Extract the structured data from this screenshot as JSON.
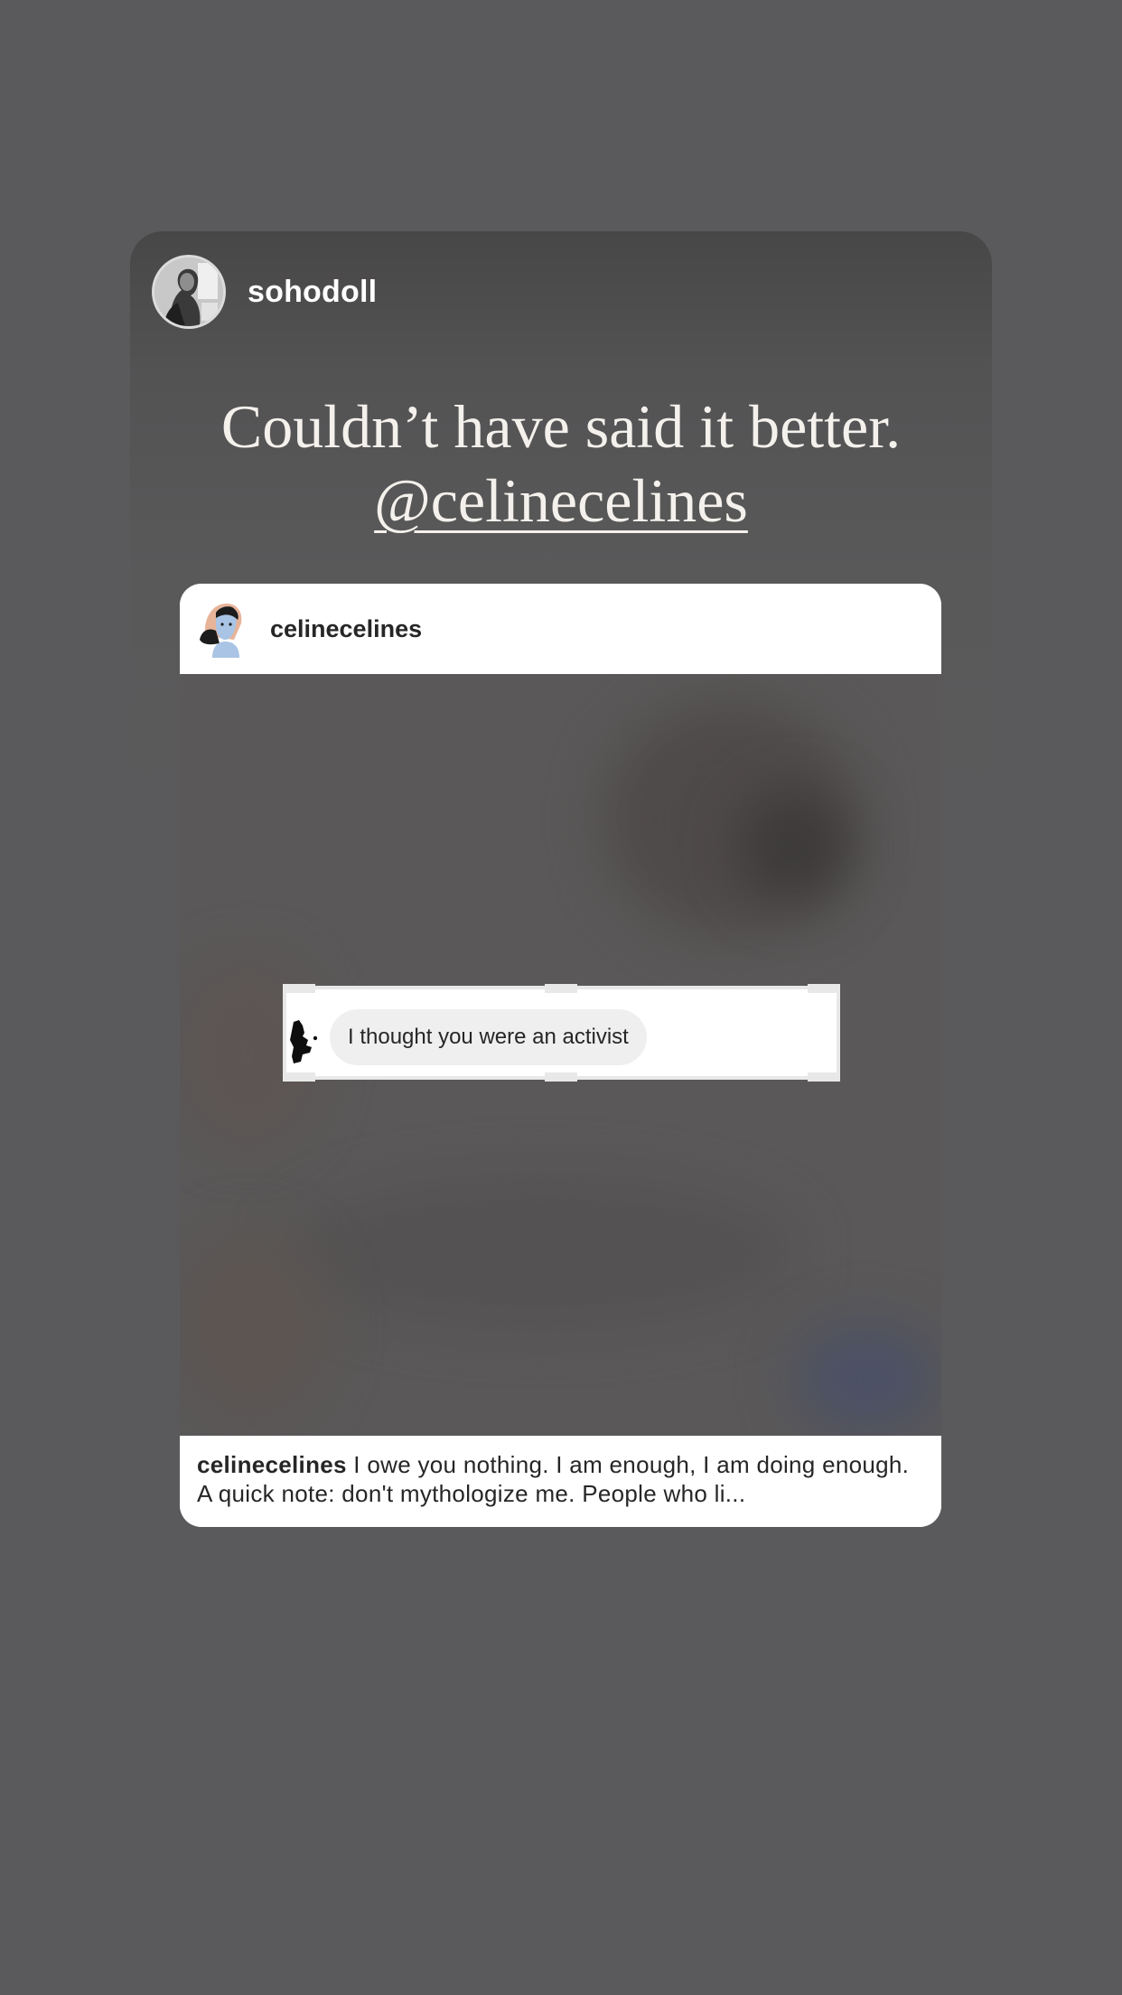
{
  "story": {
    "username": "sohodoll",
    "caption_line1": "Couldn’t have said it better.",
    "caption_mention": "@celinecelines"
  },
  "shared_post": {
    "username": "celinecelines",
    "dm_message": "I thought you were an activist",
    "caption_username": "celinecelines",
    "caption_text": " I owe you nothing. I am enough, I am doing enough. A quick note: don't mythologize me.  People who li..."
  },
  "colors": {
    "background": "#5a5a5c",
    "card_top": "#484747",
    "caption_text": "#f4f1ec",
    "post_text": "#262626"
  }
}
